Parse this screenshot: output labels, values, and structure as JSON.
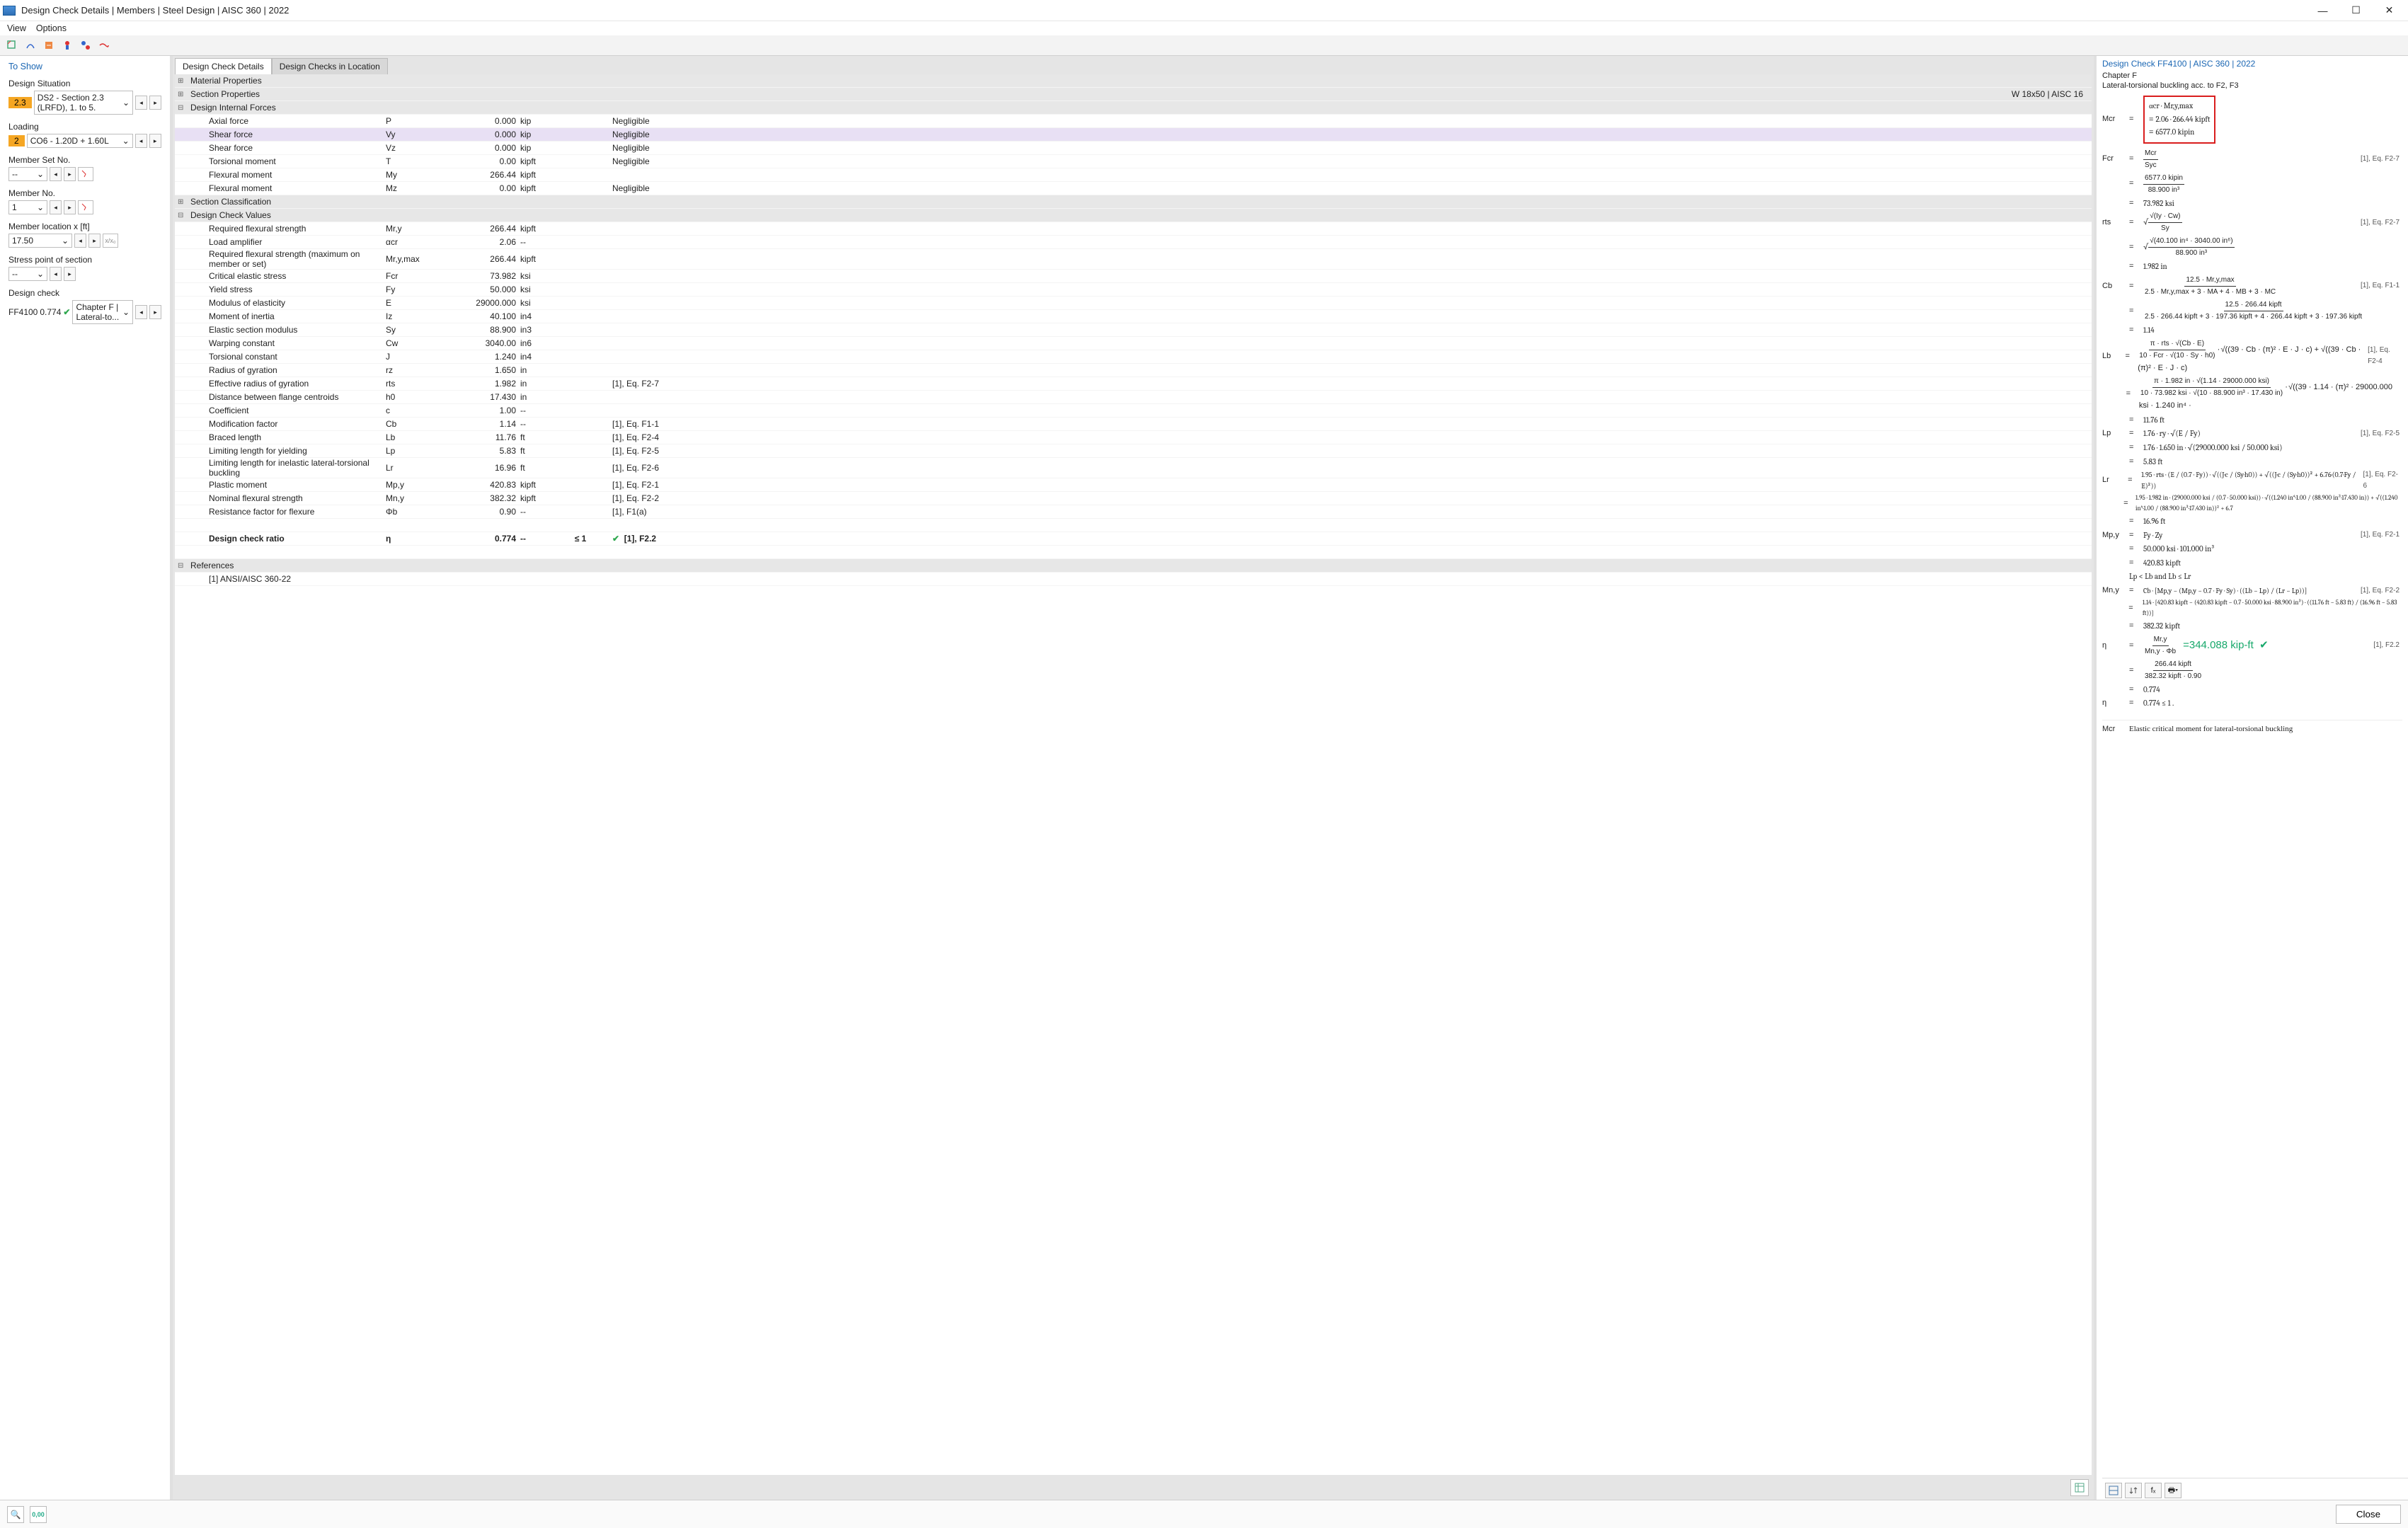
{
  "window": {
    "title": "Design Check Details | Members | Steel Design | AISC 360 | 2022"
  },
  "menu": {
    "view": "View",
    "options": "Options"
  },
  "sidebar": {
    "heading": "To Show",
    "design_situation_label": "Design Situation",
    "ds_badge": "2.3",
    "ds_text": "DS2 - Section 2.3 (LRFD), 1. to 5.",
    "loading_label": "Loading",
    "loading_badge": "2",
    "loading_text": "CO6 - 1.20D + 1.60L",
    "memberset_label": "Member Set No.",
    "memberset_text": "-- ",
    "memberno_label": "Member No.",
    "memberno_text": "1",
    "memloc_label": "Member location x [ft]",
    "memloc_text": "17.50",
    "memloc_btn": "x/x₀",
    "stress_label": "Stress point of section",
    "stress_text": "-- ",
    "designcheck_label": "Design check",
    "dc_code": "FF4100",
    "dc_ratio": "0.774",
    "dc_text": "Chapter F | Lateral-to..."
  },
  "tabs": {
    "details": "Design Check Details",
    "location": "Design Checks in Location"
  },
  "grid": {
    "mat_props": "Material Properties",
    "sec_props": "Section Properties",
    "sec_props_right": "W 18x50 | AISC 16",
    "internal": "Design Internal Forces",
    "rows_internal": [
      {
        "name": "Axial force",
        "sym": "P",
        "val": "0.000",
        "unit": "kip",
        "extra": "Negligible"
      },
      {
        "name": "Shear force",
        "sym": "Vy",
        "val": "0.000",
        "unit": "kip",
        "extra": "Negligible",
        "hl": true
      },
      {
        "name": "Shear force",
        "sym": "Vz",
        "val": "0.000",
        "unit": "kip",
        "extra": "Negligible"
      },
      {
        "name": "Torsional moment",
        "sym": "T",
        "val": "0.00",
        "unit": "kipft",
        "extra": "Negligible"
      },
      {
        "name": "Flexural moment",
        "sym": "My",
        "val": "266.44",
        "unit": "kipft",
        "extra": ""
      },
      {
        "name": "Flexural moment",
        "sym": "Mz",
        "val": "0.00",
        "unit": "kipft",
        "extra": "Negligible"
      }
    ],
    "sec_class": "Section Classification",
    "dcv": "Design Check Values",
    "rows_dcv": [
      {
        "name": "Required flexural strength",
        "sym": "Mr,y",
        "val": "266.44",
        "unit": "kipft",
        "ref": ""
      },
      {
        "name": "Load amplifier",
        "sym": "αcr",
        "val": "2.06",
        "unit": "--",
        "ref": ""
      },
      {
        "name": "Required flexural strength (maximum on member or set)",
        "sym": "Mr,y,max",
        "val": "266.44",
        "unit": "kipft",
        "ref": ""
      },
      {
        "name": "Critical elastic stress",
        "sym": "Fcr",
        "val": "73.982",
        "unit": "ksi",
        "ref": ""
      },
      {
        "name": "Yield stress",
        "sym": "Fy",
        "val": "50.000",
        "unit": "ksi",
        "ref": ""
      },
      {
        "name": "Modulus of elasticity",
        "sym": "E",
        "val": "29000.000",
        "unit": "ksi",
        "ref": ""
      },
      {
        "name": "Moment of inertia",
        "sym": "Iz",
        "val": "40.100",
        "unit": "in4",
        "ref": ""
      },
      {
        "name": "Elastic section modulus",
        "sym": "Sy",
        "val": "88.900",
        "unit": "in3",
        "ref": ""
      },
      {
        "name": "Warping constant",
        "sym": "Cw",
        "val": "3040.00",
        "unit": "in6",
        "ref": ""
      },
      {
        "name": "Torsional constant",
        "sym": "J",
        "val": "1.240",
        "unit": "in4",
        "ref": ""
      },
      {
        "name": "Radius of gyration",
        "sym": "rz",
        "val": "1.650",
        "unit": "in",
        "ref": ""
      },
      {
        "name": "Effective radius of gyration",
        "sym": "rts",
        "val": "1.982",
        "unit": "in",
        "ref": "[1], Eq. F2-7"
      },
      {
        "name": "Distance between flange centroids",
        "sym": "h0",
        "val": "17.430",
        "unit": "in",
        "ref": ""
      },
      {
        "name": "Coefficient",
        "sym": "c",
        "val": "1.00",
        "unit": "--",
        "ref": ""
      },
      {
        "name": "Modification factor",
        "sym": "Cb",
        "val": "1.14",
        "unit": "--",
        "ref": "[1], Eq. F1-1"
      },
      {
        "name": "Braced length",
        "sym": "Lb",
        "val": "11.76",
        "unit": "ft",
        "ref": "[1], Eq. F2-4"
      },
      {
        "name": "Limiting length for yielding",
        "sym": "Lp",
        "val": "5.83",
        "unit": "ft",
        "ref": "[1], Eq. F2-5"
      },
      {
        "name": "Limiting length for inelastic lateral-torsional buckling",
        "sym": "Lr",
        "val": "16.96",
        "unit": "ft",
        "ref": "[1], Eq. F2-6"
      },
      {
        "name": "Plastic moment",
        "sym": "Mp,y",
        "val": "420.83",
        "unit": "kipft",
        "ref": "[1], Eq. F2-1"
      },
      {
        "name": "Nominal flexural strength",
        "sym": "Mn,y",
        "val": "382.32",
        "unit": "kipft",
        "ref": "[1], Eq. F2-2"
      },
      {
        "name": "Resistance factor for flexure",
        "sym": "Φb",
        "val": "0.90",
        "unit": "--",
        "ref": "[1], F1(a)"
      }
    ],
    "ratio": {
      "name": "Design check ratio",
      "sym": "η",
      "val": "0.774",
      "unit": "--",
      "limit": "≤ 1",
      "ref": "[1], F2.2"
    },
    "refs_hdr": "References",
    "refs": "[1] ANSI/AISC 360-22"
  },
  "right": {
    "header": "Design Check FF4100 | AISC 360 | 2022",
    "chapter": "Chapter F",
    "subtitle": "Lateral-torsional buckling acc. to F2, F3",
    "red1": "αcr · Mr,y,max",
    "red2": "2.06 · 266.44 kipft",
    "red3": "6577.0 kipin",
    "l_mcr": "Mcr",
    "l_fcr": "Fcr",
    "fcr_a": "Mcr",
    "fcr_b": "Syc",
    "fcr_c": "6577.0 kipin",
    "fcr_d": "88.900 in³",
    "fcr_e": "73.982 ksi",
    "l_rts": "rts",
    "rts_eq": "F2-7",
    "rts_a": "√(Iy · Cw)",
    "rts_b": "Sy",
    "rts_c": "√(40.100 in⁴ · 3040.00 in⁶)",
    "rts_d": "88.900 in³",
    "rts_e": "1.982 in",
    "l_cb": "Cb",
    "cb_eq": "F1-1",
    "cb_a": "12.5 · Mr,y,max",
    "cb_b": "2.5 · Mr,y,max + 3 · MA + 4 · MB + 3 · MC",
    "cb_c": "12.5 · 266.44 kipft",
    "cb_d": "2.5 · 266.44 kipft + 3 · 197.36 kipft + 4 · 266.44 kipft + 3 · 197.36 kipft",
    "cb_e": "1.14",
    "l_lb": "Lb",
    "lb_eq": "F2-4",
    "lb_a": "π · rts · √(Cb · E)",
    "lb_b": "10 · Fcr · √(10 · Sy · h0)",
    "lb_c": "√((39 · Cb · (π)² · E · J · c) + √((39 · Cb · (π)² · E · J · c)",
    "lb_d": "π · 1.982 in · √(1.14 · 29000.000 ksi)",
    "lb_e": "10 · 73.982 ksi · √(10 · 88.900 in³ · 17.430 in)",
    "lb_f": "√((39 · 1.14 · (π)² · 29000.000 ksi · 1.240 in⁴ ·",
    "lb_g": "11.76 ft",
    "l_lp": "Lp",
    "lp_eq": "F2-5",
    "lp_a": "1.76 · ry · √(E / Fy)",
    "lp_b": "1.76 · 1.650 in · √(29000.000 ksi / 50.000 ksi)",
    "lp_c": "5.83 ft",
    "l_lr": "Lr",
    "lr_eq": "F2-6",
    "lr_a": "1.95 · rts · (E / (0.7 · Fy)) · √((J·c / (Sy·h0)) + √((J·c / (Sy·h0))² + 6.76·(0.7·Fy / E)²))",
    "lr_b": "1.95 · 1.982 in · (29000.000 ksi / (0.7 · 50.000 ksi)) · √((1.240 in⁴·1.00 / (88.900 in³·17.430 in)) + √((1.240 in⁴·1.00 / (88.900 in³·17.430 in))² + 6.7",
    "lr_c": "16.96 ft",
    "l_mpy": "Mp,y",
    "mpy_eq": "F2-1",
    "mpy_a": "Fy · Zy",
    "mpy_b": "50.000 ksi · 101.000 in³",
    "mpy_c": "420.83 kipft",
    "cond": "Lp < Lb and Lb ≤ Lr",
    "l_mny": "Mn,y",
    "mny_eq": "F2-2",
    "mny_a": "Cb · [Mp,y − (Mp,y − 0.7 · Fy · Sy) · ((Lb − Lp) / (Lr − Lp))]",
    "mny_b": "1.14 · [420.83 kipft − (420.83 kipft − 0.7 · 50.000 ksi · 88.900 in³) · ((11.76 ft − 5.83 ft) / (16.96 ft − 5.83 ft))]",
    "mny_c": "382.32 kipft",
    "l_eta": "η",
    "eta_eq": "F2.2",
    "eta_a": "Mr,y",
    "eta_b": "Mn,y · Φb",
    "eta_c": "266.44 kipft",
    "eta_d": "382.32 kipft · 0.90",
    "eta_e": "0.774",
    "eta_cond": "0.774 ≤ 1 .",
    "result_green": "=344.088 kip-ft",
    "ft_def": "Elastic critical moment for lateral-torsional buckling"
  },
  "footer": {
    "close": "Close"
  }
}
